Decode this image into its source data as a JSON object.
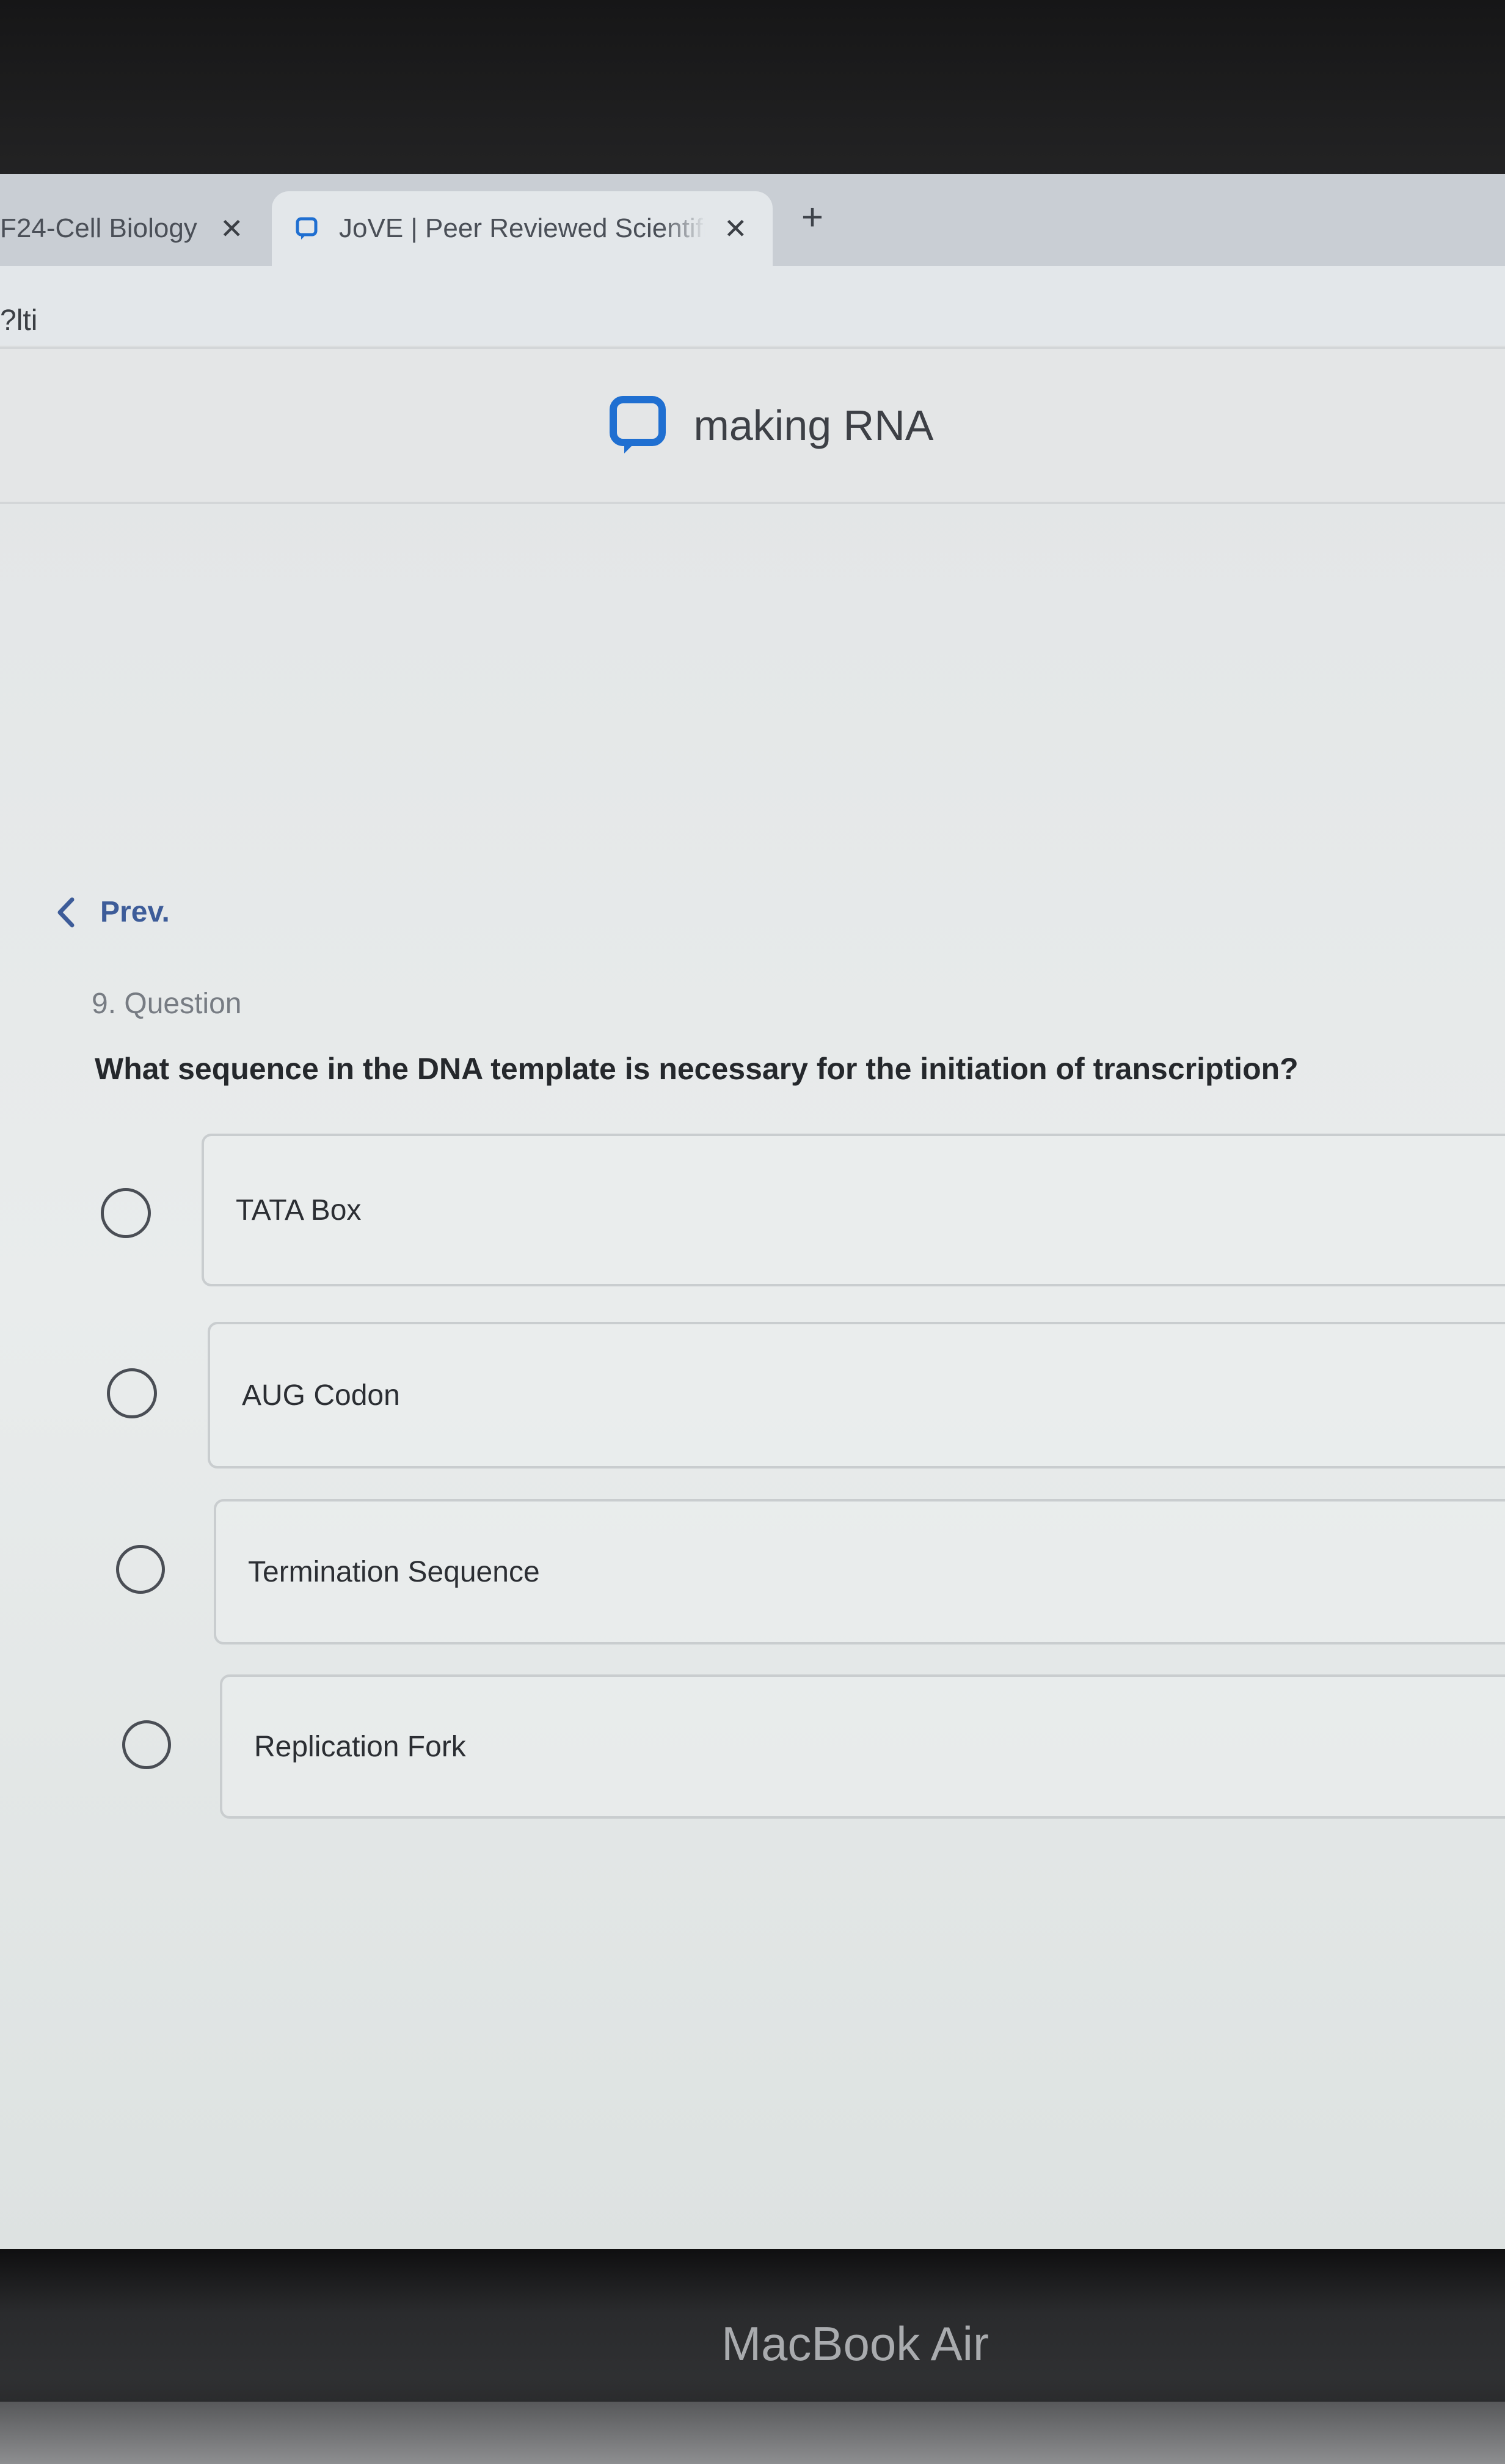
{
  "browser": {
    "tabs": [
      {
        "title": "F24-Cell Biology",
        "close": "✕",
        "active": false
      },
      {
        "title": "JoVE | Peer Reviewed Scientific",
        "close": "✕",
        "active": true
      }
    ],
    "new_tab": "+",
    "url_fragment": "?lti"
  },
  "header": {
    "icon": "chat-bubble-icon",
    "title": "making RNA"
  },
  "nav": {
    "prev_label": "Prev."
  },
  "question": {
    "number_label": "9. Question",
    "text": "What sequence in the DNA template is necessary for the initiation of transcription?",
    "options": [
      {
        "label": "TATA Box",
        "selected": false
      },
      {
        "label": "AUG Codon",
        "selected": false
      },
      {
        "label": "Termination Sequence",
        "selected": false
      },
      {
        "label": "Replication Fork",
        "selected": false
      }
    ]
  },
  "device": {
    "label": "MacBook Air"
  },
  "colors": {
    "accent": "#1f6fd1",
    "link": "#3d5c99"
  }
}
